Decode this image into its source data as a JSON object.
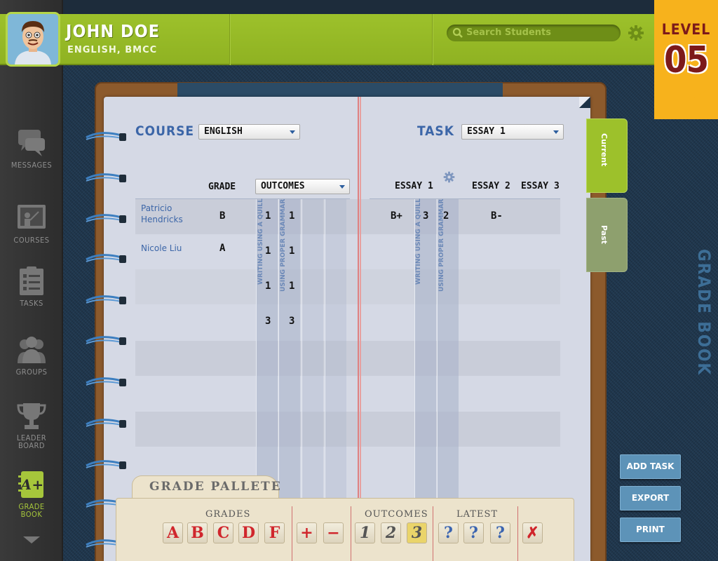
{
  "user": {
    "name": "JOHN DOE",
    "subtitle": "ENGLISH, BMCC"
  },
  "search": {
    "placeholder": "Search Students"
  },
  "level": {
    "label": "LEVEL",
    "value": "05"
  },
  "sidebar": {
    "items": [
      {
        "label": "MESSAGES",
        "icon": "speech-bubbles-icon"
      },
      {
        "label": "COURSES",
        "icon": "chalkboard-icon"
      },
      {
        "label": "TASKS",
        "icon": "checklist-icon"
      },
      {
        "label": "GROUPS",
        "icon": "people-icon"
      },
      {
        "label_line1": "LEADER",
        "label_line2": "BOARD",
        "icon": "trophy-icon"
      },
      {
        "label_line1": "GRADE",
        "label_line2": "BOOK",
        "icon": "grade-book-icon",
        "active": true
      }
    ]
  },
  "course": {
    "label": "COURSE",
    "selected": "ENGLISH"
  },
  "task": {
    "label": "TASK",
    "selected": "ESSAY 1"
  },
  "left_table": {
    "headers": {
      "grade": "GRADE",
      "outcomes_select": "OUTCOMES"
    },
    "outcome_columns": [
      "WRITING USING A QUILL",
      "USING PROPER GRAMMAR"
    ],
    "rows": [
      {
        "student": "Patricio Hendricks",
        "grade": "B",
        "o1": "1",
        "o2": "1"
      },
      {
        "student": "Nicole Liu",
        "grade": "A",
        "o1": "1",
        "o2": "1"
      },
      {
        "student": "",
        "grade": "",
        "o1": "1",
        "o2": "1"
      },
      {
        "student": "",
        "grade": "",
        "o1": "3",
        "o2": "3"
      }
    ]
  },
  "right_table": {
    "headers": [
      "ESSAY 1",
      "ESSAY 2",
      "ESSAY 3"
    ],
    "outcome_columns": [
      "WRITING USING A QUILL",
      "USING PROPER GRAMMAR"
    ],
    "rows": [
      {
        "essay1": "B+",
        "o1": "3",
        "o2": "2",
        "essay2": "B-"
      }
    ]
  },
  "tabs": {
    "current": "Current",
    "past": "Past"
  },
  "side_label": "GRADE BOOK",
  "actions": {
    "add_task": "ADD TASK",
    "export": "EXPORT",
    "print": "PRINT"
  },
  "pallete": {
    "title": "GRADE PALLETE",
    "groups": {
      "grades": "GRADES",
      "outcomes": "OUTCOMES",
      "latest": "LATEST"
    },
    "grades": [
      "A",
      "B",
      "C",
      "D",
      "F"
    ],
    "modifiers": [
      "+",
      "−"
    ],
    "outcomes": [
      "1",
      "2",
      "3"
    ],
    "latest": [
      "?",
      "?",
      "?"
    ],
    "clear": "✗"
  },
  "colors": {
    "accent_green": "#9dc12b",
    "level_badge": "#f7b21c",
    "title_blue": "#3c66a8",
    "grade_red": "#d0262c"
  }
}
